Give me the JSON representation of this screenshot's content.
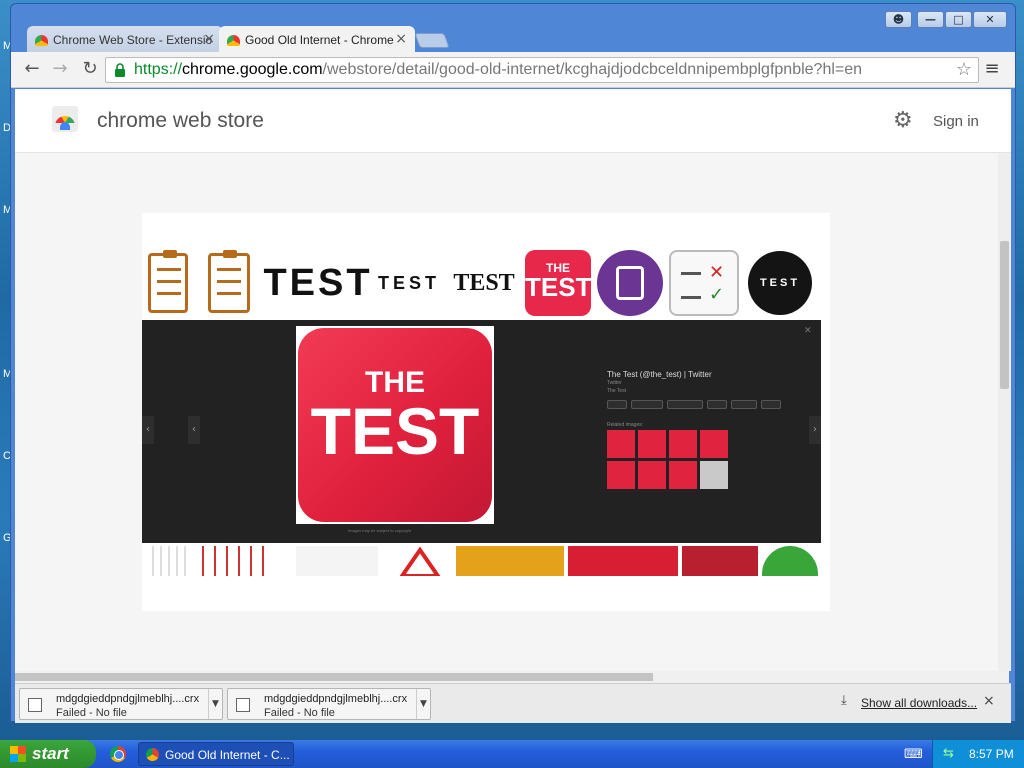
{
  "desktop": {
    "side_letters": [
      "M",
      "D",
      "M",
      "M",
      "C",
      "G"
    ]
  },
  "window": {
    "controls": [
      "&#128100;",
      "&#8212;",
      "&#9633;",
      "&#10005;"
    ],
    "tabs": [
      {
        "title": "Chrome Web Store - Extensio",
        "close": "×"
      },
      {
        "title": "Good Old Internet - Chrome",
        "close": "×"
      }
    ]
  },
  "toolbar": {
    "back": "←",
    "forward": "→",
    "reload": "↻",
    "url_scheme": "https://",
    "url_host": "chrome.google.com",
    "url_path": "/webstore/detail/good-old-internet/kcghajdjodcbceldnnipembplgfpnble?hl=en",
    "star": "☆",
    "menu": "≡"
  },
  "cws": {
    "title": "chrome web store",
    "gear": "⚙",
    "signin": "Sign in"
  },
  "screenshot": {
    "strip_text": [
      "TEST",
      "TEST",
      "TEST"
    ],
    "red_icon_line1": "THE",
    "red_icon_line2": "TEST",
    "black_circle": "TEST",
    "viewer": {
      "big_line1": "THE",
      "big_line2": "TEST",
      "title": "The Test (@the_test) | Twitter",
      "sub1": "Twitter",
      "sub2": "The Test",
      "related_label": "Related images:",
      "footer": "Images may be subject to copyright"
    }
  },
  "downloads": {
    "items": [
      {
        "name": "mdgdgieddpndgjlmeblhj....crx",
        "status": "Failed - No file"
      },
      {
        "name": "mdgdgieddpndgjlmeblhj....crx",
        "status": "Failed - No file"
      }
    ],
    "show_all": "Show all downloads...",
    "close": "×"
  },
  "taskbar": {
    "start": "start",
    "task_title": "Good Old Internet - C...",
    "clock": "8:57 PM"
  }
}
